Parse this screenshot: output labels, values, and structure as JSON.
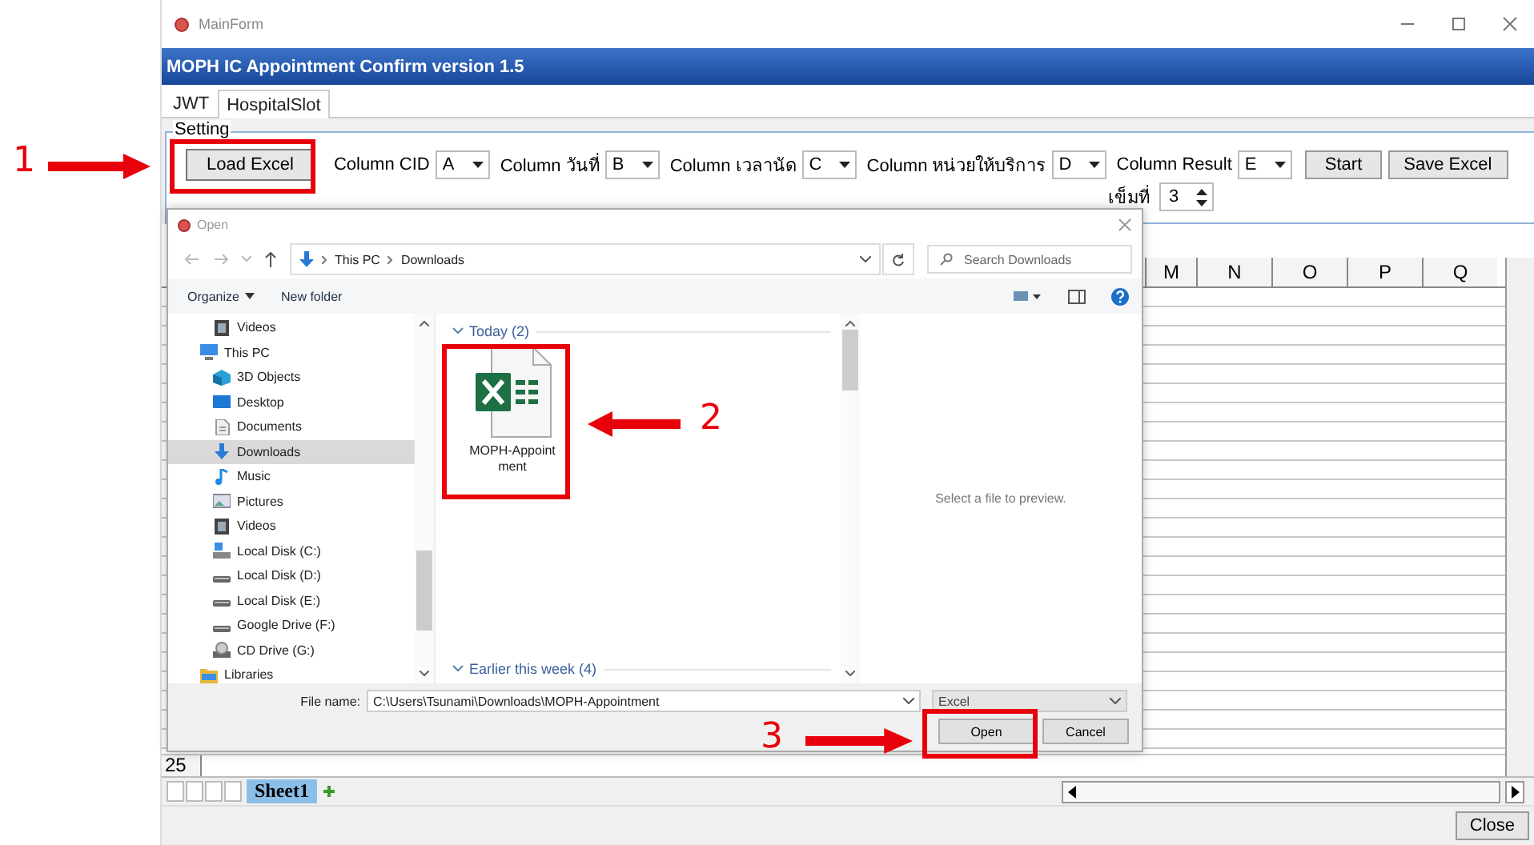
{
  "window": {
    "title": "MainForm"
  },
  "app_title": "MOPH IC Appointment Confirm version 1.5",
  "tabs": [
    {
      "label": "JWT",
      "selected": false
    },
    {
      "label": "HospitalSlot",
      "selected": true
    }
  ],
  "setting": {
    "title": "Setting",
    "load_button": "Load Excel",
    "columns": [
      {
        "label": "Column CID",
        "value": "A"
      },
      {
        "label": "Column วันที่",
        "value": "B"
      },
      {
        "label": "Column เวลานัด",
        "value": "C"
      },
      {
        "label": "Column หน่วยให้บริการ",
        "value": "D"
      },
      {
        "label": "Column Result",
        "value": "E"
      }
    ],
    "start_button": "Start",
    "save_button": "Save Excel",
    "dose_label": "เข็มที่",
    "dose_value": "3"
  },
  "grid": {
    "columns": [
      "M",
      "N",
      "O",
      "P",
      "Q"
    ],
    "row_label": "25"
  },
  "sheet_tabs": [
    {
      "label": "Sheet1",
      "selected": true
    }
  ],
  "close_button": "Close",
  "dialog": {
    "title": "Open",
    "path": [
      "This PC",
      "Downloads"
    ],
    "search": {
      "placeholder": "Search Downloads"
    },
    "toolbar": [
      "Organize",
      "New folder"
    ],
    "tree": [
      {
        "children": [
          {
            "label": "Videos",
            "kind": "video",
            "selected": false
          }
        ]
      },
      {
        "label": "This PC",
        "kind": "pc",
        "selected": false,
        "children": [
          {
            "label": "3D Objects",
            "kind": "cube",
            "selected": false
          },
          {
            "label": "Desktop",
            "kind": "desktop",
            "selected": false
          },
          {
            "label": "Documents",
            "kind": "document",
            "selected": false
          },
          {
            "label": "Downloads",
            "kind": "download",
            "selected": true
          },
          {
            "label": "Music",
            "kind": "music",
            "selected": false
          },
          {
            "label": "Pictures",
            "kind": "pictures",
            "selected": false
          },
          {
            "label": "Videos",
            "kind": "video",
            "selected": false
          },
          {
            "label": "Local Disk (C:)",
            "kind": "system",
            "selected": false
          },
          {
            "label": "Local Disk (D:)",
            "kind": "drive",
            "selected": false
          },
          {
            "label": "Local Disk (E:)",
            "kind": "drive",
            "selected": false
          },
          {
            "label": "Google Drive (F:)",
            "kind": "drive",
            "selected": false
          },
          {
            "label": "CD Drive (G:)",
            "kind": "cd",
            "selected": false
          }
        ]
      },
      {
        "label": "Libraries",
        "kind": "folder",
        "selected": false
      }
    ],
    "groups": [
      {
        "label": "Today (2)",
        "expanded": true,
        "files": [
          {
            "name": "MOPH-Appointment"
          }
        ]
      },
      {
        "label": "Earlier this week (4)",
        "expanded": true
      }
    ],
    "preview_text": "Select a file to preview.",
    "file_name_label": "File name:",
    "file_name": "C:\\Users\\Tsunami\\Downloads\\MOPH-Appointment",
    "file_type": "Excel",
    "buttons": [
      "Open",
      "Cancel"
    ]
  },
  "annotations": [
    {
      "label": "1"
    },
    {
      "label": "2"
    },
    {
      "label": "3"
    }
  ]
}
